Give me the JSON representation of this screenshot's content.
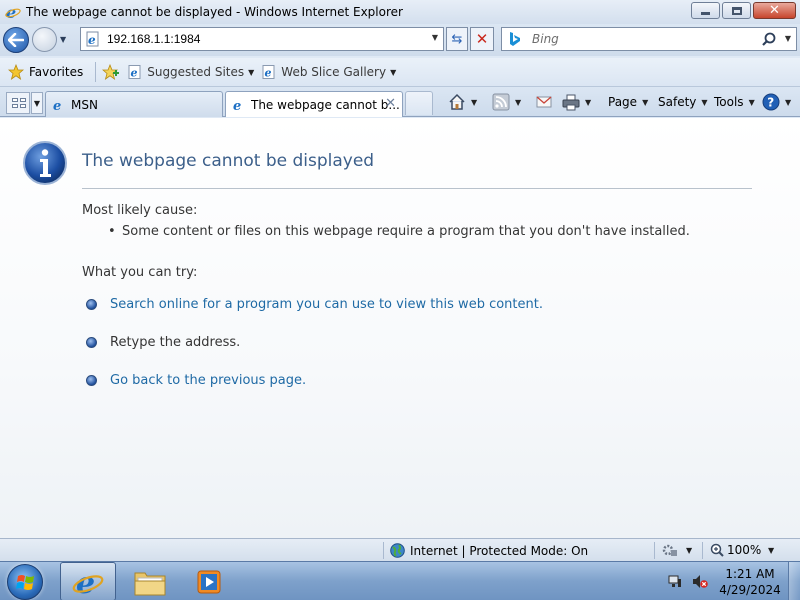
{
  "window": {
    "title": "The webpage cannot be displayed - Windows Internet Explorer"
  },
  "address_bar": {
    "url": "192.168.1.1:1984"
  },
  "search": {
    "placeholder": "Bing"
  },
  "favorites_bar": {
    "favorites_label": "Favorites",
    "links": [
      {
        "label": "Suggested Sites",
        "icon": "ie-icon"
      },
      {
        "label": "Web Slice Gallery",
        "icon": "ie-icon"
      }
    ]
  },
  "tabs": [
    {
      "label": "MSN",
      "active": false,
      "icon": "ie-icon"
    },
    {
      "label": "The webpage cannot b...",
      "active": true,
      "icon": "ie-icon"
    }
  ],
  "command_bar": {
    "page_label": "Page",
    "safety_label": "Safety",
    "tools_label": "Tools"
  },
  "error_page": {
    "title": "The webpage cannot be displayed",
    "cause_heading": "Most likely cause:",
    "causes": [
      "Some content or files on this webpage require a program that you don't have installed."
    ],
    "try_heading": "What you can try:",
    "suggestions": [
      {
        "text": "Search online for a program you can use to view this web content.",
        "type": "link"
      },
      {
        "text": "Retype the address.",
        "type": "plain"
      },
      {
        "text": "Go back to the previous page.",
        "type": "link"
      }
    ]
  },
  "status_bar": {
    "zone": "Internet | Protected Mode: On",
    "zoom": "100%"
  },
  "taskbar": {
    "time": "1:21 AM",
    "date": "4/29/2024"
  },
  "colors": {
    "link": "#1f6aa5",
    "heading": "#3c5f8a",
    "chrome": "#dbe6f3"
  }
}
